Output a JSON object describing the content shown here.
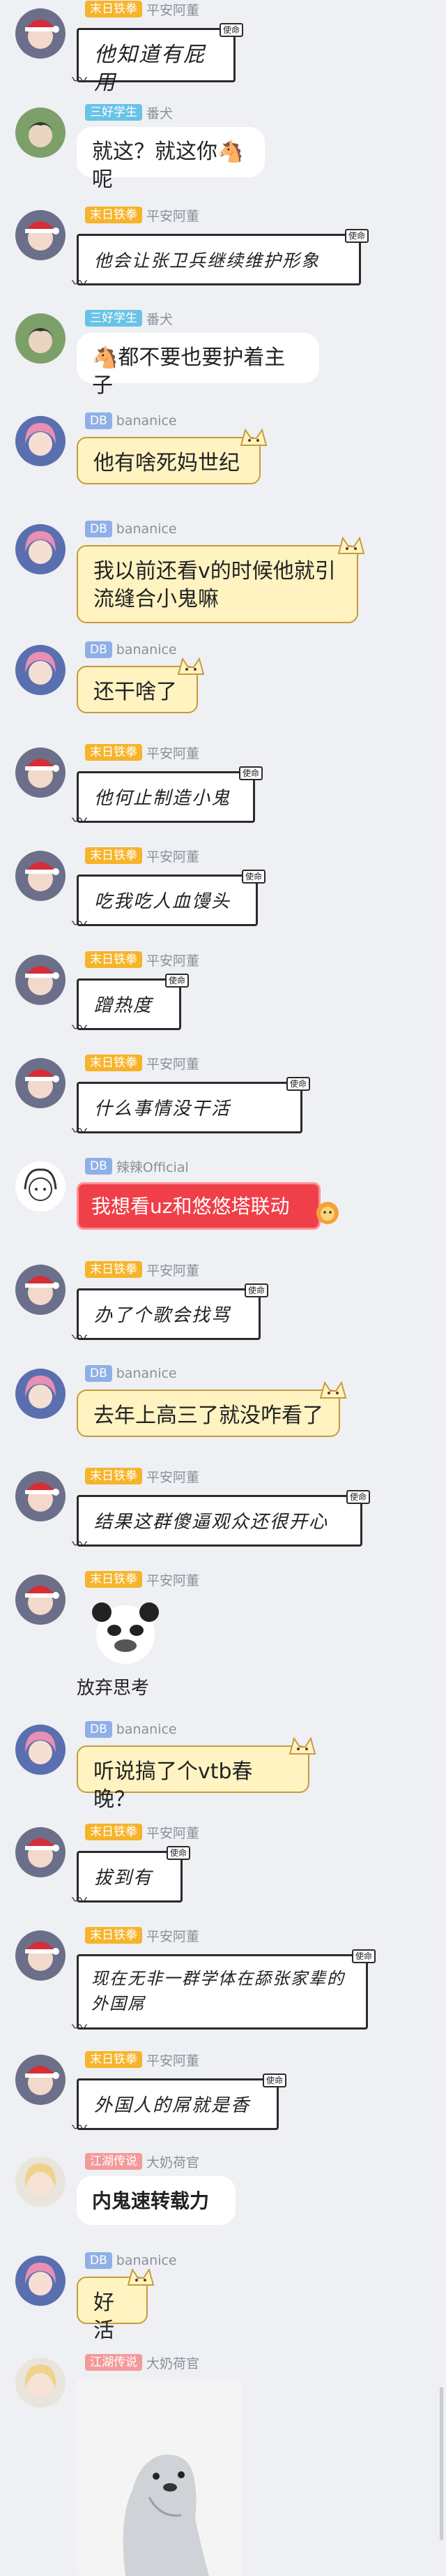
{
  "colors": {
    "background": "#eef0f4",
    "badge_orange": "#f6b42b",
    "badge_cyan": "#69c3e6",
    "badge_blue": "#8fb0e6",
    "badge_pink": "#f39a9a",
    "bubble_red": "#ef4049",
    "bubble_yellow": "#fff3c2"
  },
  "paper_tag": "使命",
  "messages": [
    {
      "badge": "末日铁拳",
      "nick": "平安阿董",
      "text": "他知道有屁用"
    },
    {
      "badge": "三好学生",
      "nick": "番犬",
      "text": "就这？就这你🐴呢"
    },
    {
      "badge": "末日铁拳",
      "nick": "平安阿董",
      "text": "他会让张卫兵继续维护形象"
    },
    {
      "badge": "三好学生",
      "nick": "番犬",
      "text": "🐴都不要也要护着主子"
    },
    {
      "badge": "DB",
      "nick": "bananice",
      "text": "他有啥死妈世纪"
    },
    {
      "badge": "DB",
      "nick": "bananice",
      "text": "我以前还看v的时候他就引流缝合小鬼嘛"
    },
    {
      "badge": "DB",
      "nick": "bananice",
      "text": "还干啥了"
    },
    {
      "badge": "末日铁拳",
      "nick": "平安阿董",
      "text": "他何止制造小鬼"
    },
    {
      "badge": "末日铁拳",
      "nick": "平安阿董",
      "text": "吃我吃人血馒头"
    },
    {
      "badge": "末日铁拳",
      "nick": "平安阿董",
      "text": "蹭热度"
    },
    {
      "badge": "末日铁拳",
      "nick": "平安阿董",
      "text": "什么事情没干活"
    },
    {
      "badge": "DB",
      "nick": "辣辣Official",
      "text": "我想看uz和悠悠塔联动"
    },
    {
      "badge": "末日铁拳",
      "nick": "平安阿董",
      "text": "办了个歌会找骂"
    },
    {
      "badge": "DB",
      "nick": "bananice",
      "text": "去年上高三了就没咋看了"
    },
    {
      "badge": "末日铁拳",
      "nick": "平安阿董",
      "text": "结果这群傻逼观众还很开心"
    },
    {
      "badge": "末日铁拳",
      "nick": "平安阿董",
      "text": "放弃思考"
    },
    {
      "badge": "DB",
      "nick": "bananice",
      "text": "听说搞了个vtb春晚？"
    },
    {
      "badge": "末日铁拳",
      "nick": "平安阿董",
      "text": "拔到有"
    },
    {
      "badge": "末日铁拳",
      "nick": "平安阿董",
      "text": "现在无非一群学体在舔张家辈的外国屌"
    },
    {
      "badge": "末日铁拳",
      "nick": "平安阿董",
      "text": "外国人的屌就是香"
    },
    {
      "badge": "江湖传说",
      "nick": "大奶荷官",
      "text": "内鬼速转载力"
    },
    {
      "badge": "DB",
      "nick": "bananice",
      "text": "好活"
    },
    {
      "badge": "江湖传说",
      "nick": "大奶荷官",
      "text": ""
    }
  ]
}
